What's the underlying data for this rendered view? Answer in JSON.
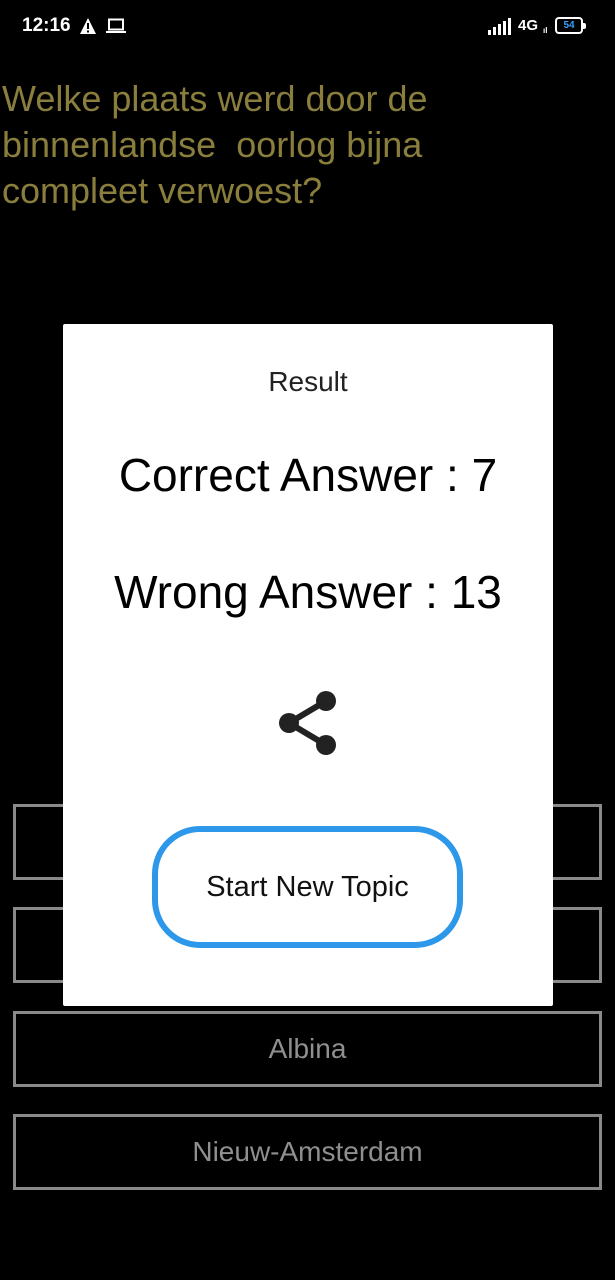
{
  "status_bar": {
    "time": "12:16",
    "network": "4G",
    "network_sub": "ıl",
    "battery": "54",
    "icons": [
      "warning-icon",
      "laptop-icon",
      "signal-icon",
      "battery-icon"
    ]
  },
  "question": {
    "text": "Welke plaats werd door de\nbinnenlandse  oorlog bijna\ncompleet verwoest?"
  },
  "options": [
    {
      "label": ""
    },
    {
      "label": ""
    },
    {
      "label": "Albina"
    },
    {
      "label": "Nieuw-Amsterdam"
    }
  ],
  "dialog": {
    "title": "Result",
    "correct_text": "Correct Answer : 7",
    "wrong_text": "Wrong Answer : 13",
    "share_icon": "share-icon",
    "button_label": "Start New Topic"
  },
  "colors": {
    "question_text": "#8a7e3d",
    "option_border": "#8a8a8a",
    "button_border": "#2d97ea",
    "battery_text": "#3aa0ff"
  }
}
